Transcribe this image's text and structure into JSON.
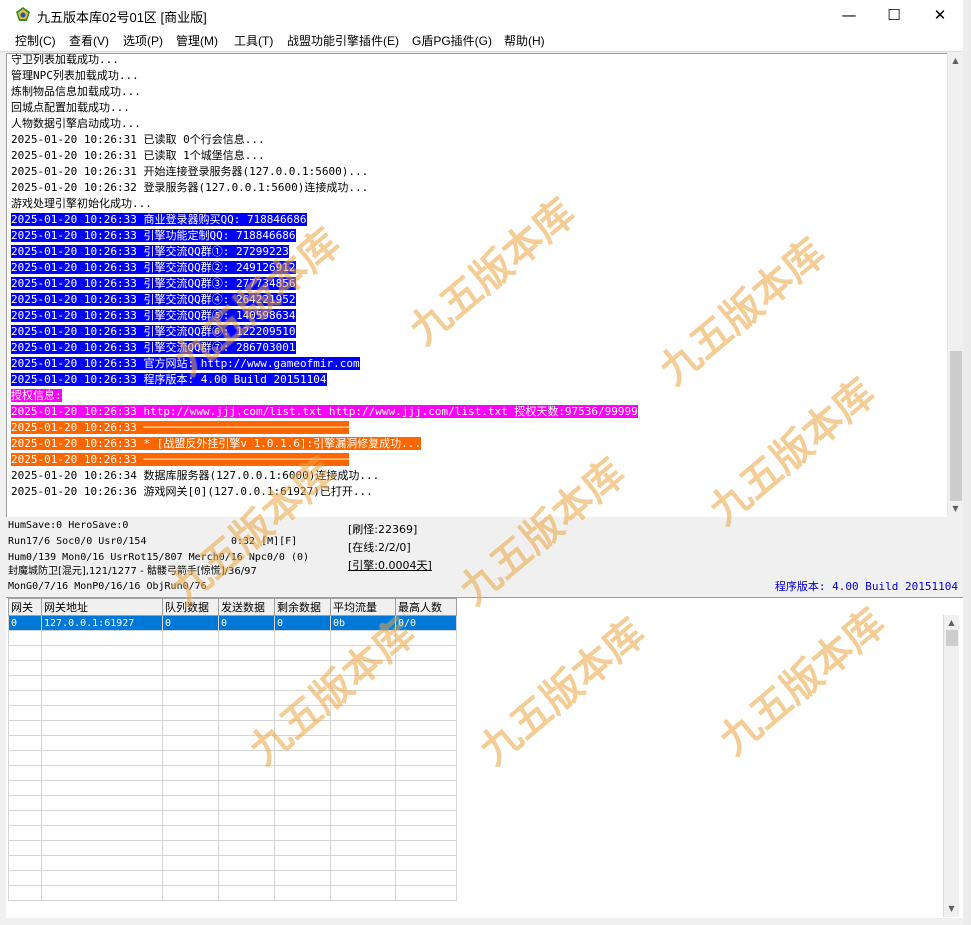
{
  "window": {
    "title": "九五版本库02号01区 [商业版]",
    "minimize": "—",
    "maximize": "☐",
    "close": "✕"
  },
  "menu": [
    "控制(C)",
    "查看(V)",
    "选项(P)",
    "管理(M)",
    "工具(T)",
    "战盟功能引擎插件(E)",
    "G盾PG插件(G)",
    "帮助(H)"
  ],
  "log": [
    {
      "text": "守卫列表加载成功...",
      "style": "plain"
    },
    {
      "text": "管理NPC列表加载成功...",
      "style": "plain"
    },
    {
      "text": "炼制物品信息加载成功...",
      "style": "plain"
    },
    {
      "text": "回城点配置加载成功...",
      "style": "plain"
    },
    {
      "text": "人物数据引擎启动成功...",
      "style": "plain"
    },
    {
      "text": "2025-01-20 10:26:31 已读取 0个行会信息...",
      "style": "plain"
    },
    {
      "text": "2025-01-20 10:26:31 已读取 1个城堡信息...",
      "style": "plain"
    },
    {
      "text": "2025-01-20 10:26:31 开始连接登录服务器(127.0.0.1:5600)...",
      "style": "plain"
    },
    {
      "text": "2025-01-20 10:26:32 登录服务器(127.0.0.1:5600)连接成功...",
      "style": "plain"
    },
    {
      "text": "游戏处理引擎初始化成功...",
      "style": "plain"
    },
    {
      "text": "2025-01-20 10:26:33 商业登录器购买QQ: 718846686",
      "style": "blue"
    },
    {
      "text": "2025-01-20 10:26:33 引擎功能定制QQ: 718846686",
      "style": "blue"
    },
    {
      "text": "2025-01-20 10:26:33 引擎交流QQ群①: 27299223",
      "style": "blue"
    },
    {
      "text": "2025-01-20 10:26:33 引擎交流QQ群②: 249126912",
      "style": "blue"
    },
    {
      "text": "2025-01-20 10:26:33 引擎交流QQ群③: 277734856",
      "style": "blue"
    },
    {
      "text": "2025-01-20 10:26:33 引擎交流QQ群④: 264221952",
      "style": "blue"
    },
    {
      "text": "2025-01-20 10:26:33 引擎交流QQ群⑤: 140598634",
      "style": "blue"
    },
    {
      "text": "2025-01-20 10:26:33 引擎交流QQ群⑥: 122209510",
      "style": "blue"
    },
    {
      "text": "2025-01-20 10:26:33 引擎交流QQ群⑦: 286703001",
      "style": "blue"
    },
    {
      "text": "2025-01-20 10:26:33 官方网站: http://www.gameofmir.com",
      "style": "blue"
    },
    {
      "text": "2025-01-20 10:26:33 程序版本: 4.00 Build 20151104",
      "style": "blue"
    },
    {
      "text": "授权信息:",
      "style": "magenta"
    },
    {
      "text": "2025-01-20 10:26:33 http://www.jjj.com/list.txt http://www.jjj.com/list.txt 授权天数:97536/99999",
      "style": "magenta"
    },
    {
      "text": "2025-01-20 10:26:33 ───────────────────────────────",
      "style": "orange"
    },
    {
      "text": "2025-01-20 10:26:33 * [战盟反外挂引擎v 1.0.1.6]:引擎漏洞修复成功...",
      "style": "orange"
    },
    {
      "text": "2025-01-20 10:26:33 ───────────────────────────────",
      "style": "orange"
    },
    {
      "text": "2025-01-20 10:26:34 数据库服务器(127.0.0.1:6000)连接成功...",
      "style": "plain"
    },
    {
      "text": "2025-01-20 10:26:36 游戏网关[0](127.0.0.1:61927)已打开...",
      "style": "plain"
    }
  ],
  "status": {
    "line1": "HumSave:0 HeroSave:0",
    "line2": "Run17/6 Soc0/0 Usr0/154",
    "timer": "0:32 [M][F]",
    "line3": "Hum0/139 Mon0/16 UsrRot15/807 Merch0/16 Npc0/0 (0)",
    "line4": "封魔城防卫[混元],121/1277 - 骷髅弓箭手[惊慌]/36/97",
    "line5": "MonG0/7/16 MonP0/16/16 ObjRun0/76",
    "refresh": "[刷怪:22369]",
    "online": "[在线:2/2/0]",
    "engine": "[引擎:0.0004天]",
    "version": "程序版本: 4.00 Build 20151104"
  },
  "grid": {
    "headers": [
      "网关",
      "网关地址",
      "队列数据",
      "发送数据",
      "剩余数据",
      "平均流量",
      "最高人数"
    ],
    "rows": [
      [
        "0",
        "127.0.0.1:61927",
        "0",
        "0",
        "0",
        "0b",
        "0/0"
      ]
    ]
  },
  "watermark": "九五版本库",
  "colors": {
    "highlight_blue": "#0000ff",
    "highlight_magenta": "#ff00ff",
    "highlight_orange": "#ff6600",
    "selection": "#0078d7"
  }
}
